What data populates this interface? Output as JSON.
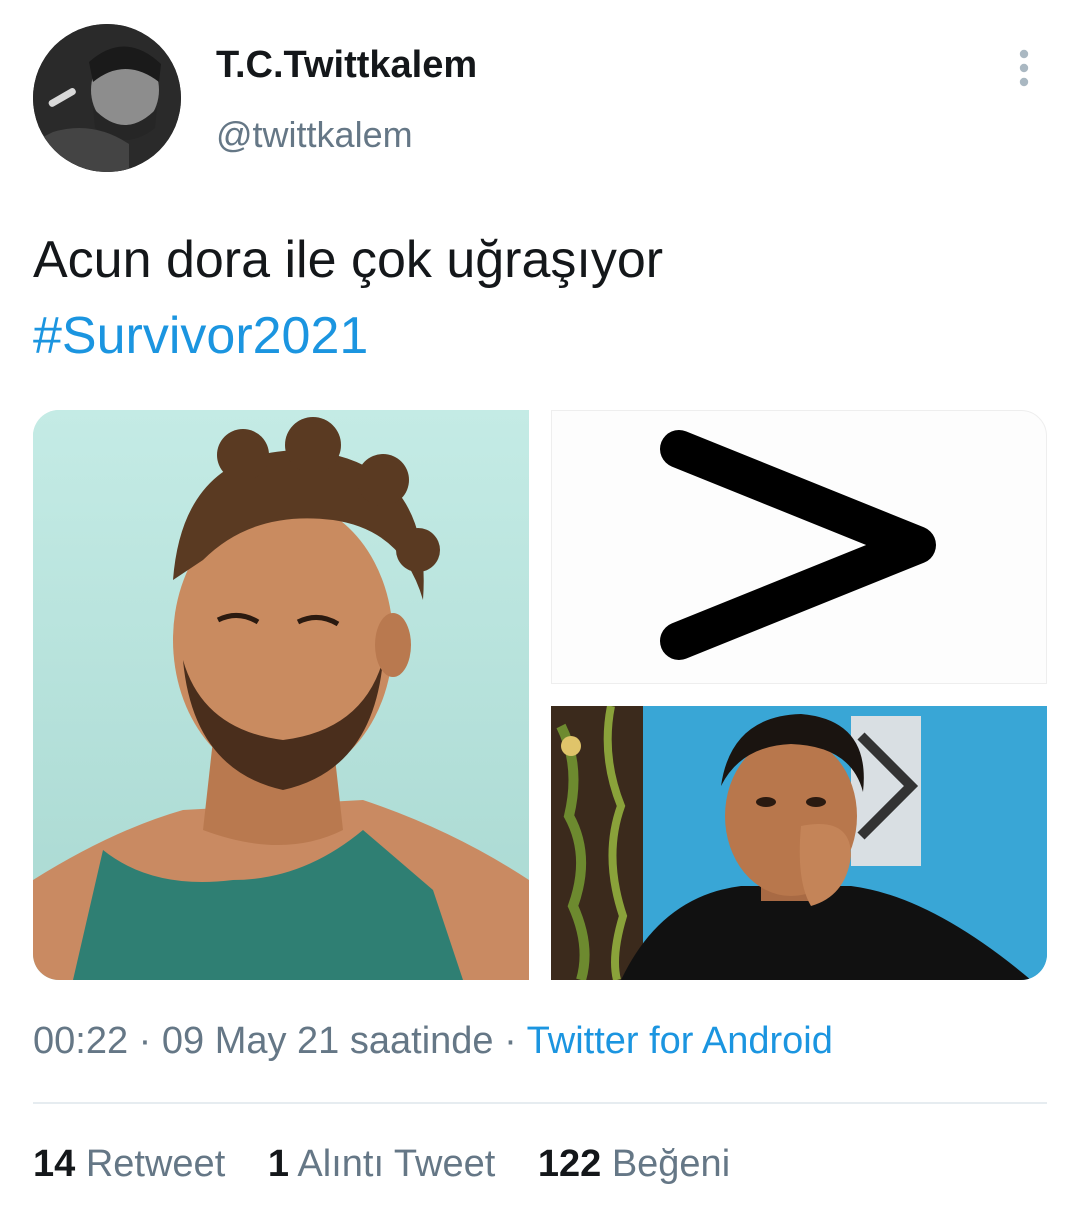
{
  "author": {
    "display_name": "T.C.Twittkalem",
    "handle": "@twittkalem"
  },
  "tweet": {
    "text": "Acun dora ile çok uğraşıyor",
    "hashtag": "#Survivor2021",
    "time": "00:22",
    "separator": "·",
    "date": "09 May 21 saatinde",
    "source": "Twitter for Android"
  },
  "media": {
    "greater_than_symbol": ">"
  },
  "stats": {
    "retweets": {
      "count": "14",
      "label": "Retweet"
    },
    "quotes": {
      "count": "1",
      "label": "Alıntı Tweet"
    },
    "likes": {
      "count": "122",
      "label": "Beğeni"
    }
  },
  "icons": {
    "more": "more-vertical-icon"
  },
  "colors": {
    "link": "#1b95e0",
    "text": "#14171a",
    "secondary": "#657786",
    "divider": "#e6ecf0"
  }
}
